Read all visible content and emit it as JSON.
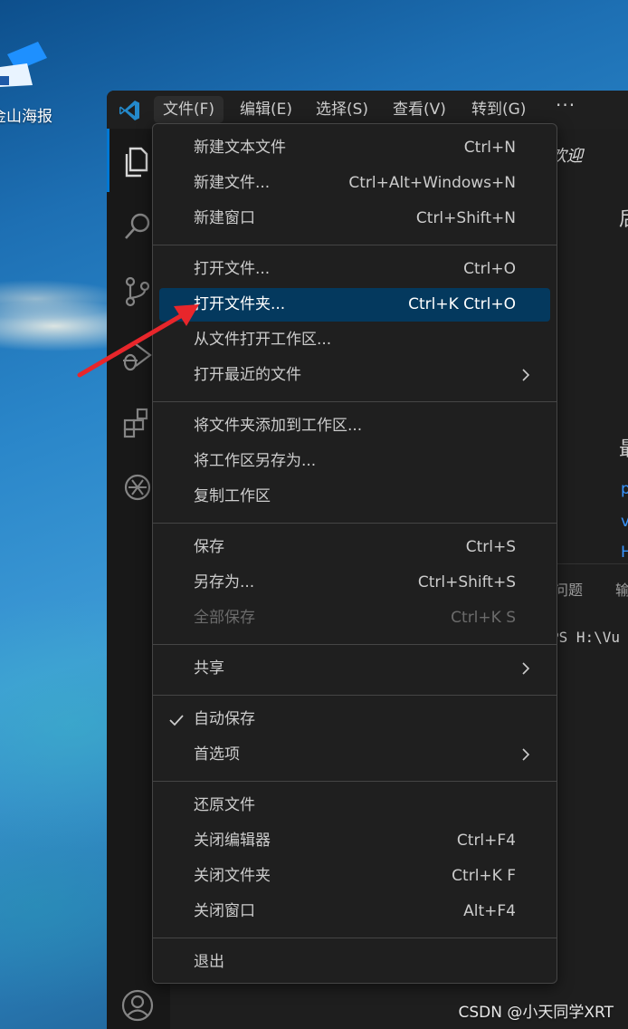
{
  "desktop": {
    "icon_label": "金山海报"
  },
  "window": {
    "menubar": [
      {
        "label": "文件(F)"
      },
      {
        "label": "编辑(E)"
      },
      {
        "label": "选择(S)"
      },
      {
        "label": "查看(V)"
      },
      {
        "label": "转到(G)"
      }
    ],
    "more": "···"
  },
  "editor": {
    "welcome_tab": "欢迎",
    "partial_heading_1": "后",
    "partial_heading_2": "最",
    "partial_links": [
      "p",
      "v",
      "H"
    ],
    "panel_tabs": [
      "问题",
      "输"
    ],
    "terminal_text": "PS H:\\Vu"
  },
  "file_menu": {
    "groups": [
      [
        {
          "label": "新建文本文件",
          "key": "Ctrl+N"
        },
        {
          "label": "新建文件...",
          "key": "Ctrl+Alt+Windows+N"
        },
        {
          "label": "新建窗口",
          "key": "Ctrl+Shift+N"
        }
      ],
      [
        {
          "label": "打开文件...",
          "key": "Ctrl+O"
        },
        {
          "label": "打开文件夹...",
          "key": "Ctrl+K Ctrl+O",
          "highlight": true
        },
        {
          "label": "从文件打开工作区...",
          "key": ""
        },
        {
          "label": "打开最近的文件",
          "key": "",
          "submenu": true
        }
      ],
      [
        {
          "label": "将文件夹添加到工作区...",
          "key": ""
        },
        {
          "label": "将工作区另存为...",
          "key": ""
        },
        {
          "label": "复制工作区",
          "key": ""
        }
      ],
      [
        {
          "label": "保存",
          "key": "Ctrl+S"
        },
        {
          "label": "另存为...",
          "key": "Ctrl+Shift+S"
        },
        {
          "label": "全部保存",
          "key": "Ctrl+K S",
          "disabled": true
        }
      ],
      [
        {
          "label": "共享",
          "key": "",
          "submenu": true
        }
      ],
      [
        {
          "label": "自动保存",
          "key": "",
          "checked": true
        },
        {
          "label": "首选项",
          "key": "",
          "submenu": true
        }
      ],
      [
        {
          "label": "还原文件",
          "key": ""
        },
        {
          "label": "关闭编辑器",
          "key": "Ctrl+F4"
        },
        {
          "label": "关闭文件夹",
          "key": "Ctrl+K F"
        },
        {
          "label": "关闭窗口",
          "key": "Alt+F4"
        }
      ],
      [
        {
          "label": "退出",
          "key": ""
        }
      ]
    ]
  },
  "icons": {
    "activity": [
      "explorer-icon",
      "search-icon",
      "source-control-icon",
      "run-debug-icon",
      "extensions-icon",
      "chatgpt-icon",
      "account-icon"
    ]
  },
  "watermark": "CSDN @小天同学XRT",
  "colors": {
    "menu_bg": "#1f1f1f",
    "highlight_bg": "#04395e",
    "accent": "#0078d4",
    "arrow": "#e8262b"
  }
}
